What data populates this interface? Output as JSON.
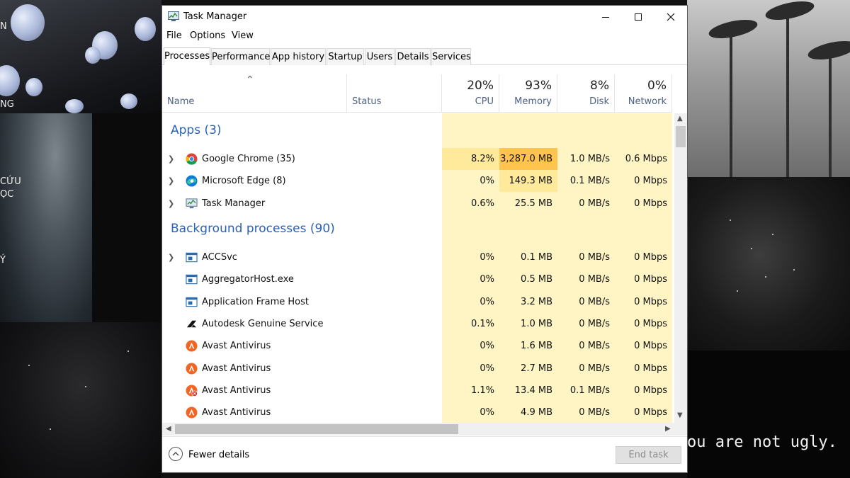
{
  "desktop": {
    "side_texts": [
      "N",
      "NG",
      "CỨU",
      "ỌC",
      "Ý"
    ],
    "quote": "ou are not ugly."
  },
  "window": {
    "title": "Task Manager",
    "menu": [
      "File",
      "Options",
      "View"
    ],
    "tabs": [
      "Processes",
      "Performance",
      "App history",
      "Startup",
      "Users",
      "Details",
      "Services"
    ],
    "active_tab": "Processes"
  },
  "columns": {
    "name": "Name",
    "status": "Status",
    "cpu": {
      "pct": "20%",
      "label": "CPU"
    },
    "memory": {
      "pct": "93%",
      "label": "Memory"
    },
    "disk": {
      "pct": "8%",
      "label": "Disk"
    },
    "network": {
      "pct": "0%",
      "label": "Network"
    }
  },
  "groups": {
    "apps": "Apps (3)",
    "background": "Background processes (90)"
  },
  "apps": [
    {
      "name": "Google Chrome (35)",
      "icon": "chrome-icon",
      "cpu": "8.2%",
      "memory": "3,287.0 MB",
      "disk": "1.0 MB/s",
      "network": "0.6 Mbps",
      "expandable": true
    },
    {
      "name": "Microsoft Edge (8)",
      "icon": "edge-icon",
      "cpu": "0%",
      "memory": "149.3 MB",
      "disk": "0.1 MB/s",
      "network": "0 Mbps",
      "expandable": true
    },
    {
      "name": "Task Manager",
      "icon": "task-manager-icon",
      "cpu": "0.6%",
      "memory": "25.5 MB",
      "disk": "0 MB/s",
      "network": "0 Mbps",
      "expandable": true
    }
  ],
  "background": [
    {
      "name": "ACCSvc",
      "icon": "service-window-icon",
      "cpu": "0%",
      "memory": "0.1 MB",
      "disk": "0 MB/s",
      "network": "0 Mbps",
      "expandable": true
    },
    {
      "name": "AggregatorHost.exe",
      "icon": "service-window-icon",
      "cpu": "0%",
      "memory": "0.5 MB",
      "disk": "0 MB/s",
      "network": "0 Mbps",
      "expandable": false
    },
    {
      "name": "Application Frame Host",
      "icon": "service-window-icon",
      "cpu": "0%",
      "memory": "3.2 MB",
      "disk": "0 MB/s",
      "network": "0 Mbps",
      "expandable": false
    },
    {
      "name": "Autodesk Genuine Service",
      "icon": "autodesk-icon",
      "cpu": "0.1%",
      "memory": "1.0 MB",
      "disk": "0 MB/s",
      "network": "0 Mbps",
      "expandable": false
    },
    {
      "name": "Avast Antivirus",
      "icon": "avast-icon",
      "cpu": "0%",
      "memory": "1.6 MB",
      "disk": "0 MB/s",
      "network": "0 Mbps",
      "expandable": false
    },
    {
      "name": "Avast Antivirus",
      "icon": "avast-icon",
      "cpu": "0%",
      "memory": "2.7 MB",
      "disk": "0 MB/s",
      "network": "0 Mbps",
      "expandable": false
    },
    {
      "name": "Avast Antivirus",
      "icon": "avast-alert-icon",
      "cpu": "1.1%",
      "memory": "13.4 MB",
      "disk": "0.1 MB/s",
      "network": "0 Mbps",
      "expandable": false
    },
    {
      "name": "Avast Antivirus",
      "icon": "avast-icon",
      "cpu": "0%",
      "memory": "4.9 MB",
      "disk": "0 MB/s",
      "network": "0 Mbps",
      "expandable": false
    }
  ],
  "footer": {
    "fewer_details": "Fewer details",
    "end_task": "End task"
  },
  "colors": {
    "heat_light": "#fff4c4",
    "heat_mid": "#ffe99a",
    "heat_high": "#ffc44d",
    "group_title": "#2a62b6"
  }
}
